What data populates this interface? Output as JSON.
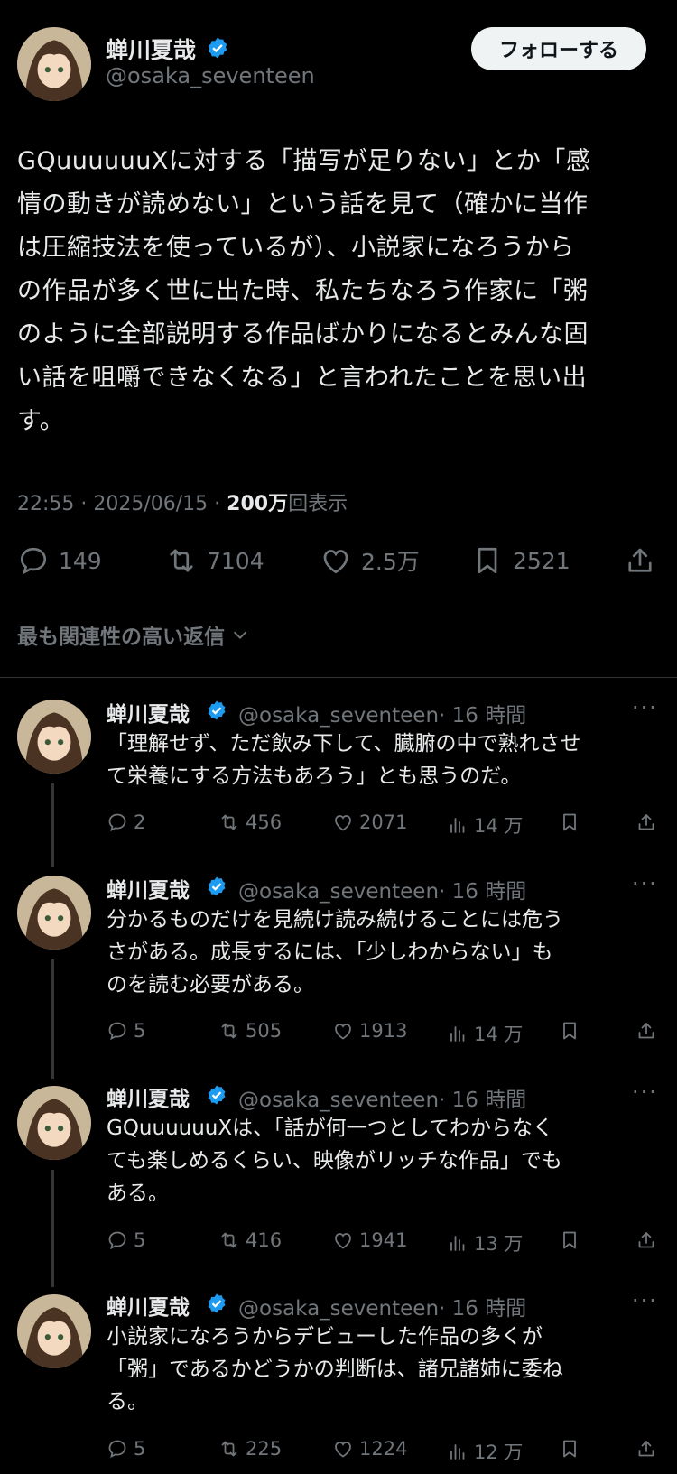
{
  "author": {
    "name": "蝉川夏哉",
    "handle": "@osaka_seventeen"
  },
  "follow_button": "フォローする",
  "post": {
    "lines": [
      "GQuuuuuuXに対する「描写が足りない」とか「感",
      "情の動きが読めない」という話を見て（確かに当作",
      "は圧縮技法を使っているが）、小説家になろうから",
      "の作品が多く世に出た時、私たちなろう作家に「粥",
      "のように全部説明する作品ばかりになるとみんな固",
      "い話を咀嚼できなくなる」と言われたことを思い出",
      "す。"
    ],
    "time": "22:55 · 2025/06/15 · ",
    "views": "200万",
    "views_suffix": "回表示",
    "stats": {
      "replies": "149",
      "reposts": "7104",
      "likes": "2.5万",
      "bookmarks": "2521"
    }
  },
  "sort_label": "最も関連性の高い返信",
  "replies": [
    {
      "name": "蝉川夏哉",
      "handle": "@osaka_seventeen",
      "time": "· 16 時間",
      "lines": [
        "「理解せず、ただ飲み下して、臓腑の中で熟れさせ",
        "て栄養にする方法もあろう」とも思うのだ。"
      ],
      "replies": "2",
      "reposts": "456",
      "likes": "2071",
      "views": "14 万"
    },
    {
      "name": "蝉川夏哉",
      "handle": "@osaka_seventeen",
      "time": "· 16 時間",
      "lines": [
        "分かるものだけを見続け読み続けることには危う",
        "さがある。成長するには、「少しわからない」も",
        "のを読む必要がある。"
      ],
      "replies": "5",
      "reposts": "505",
      "likes": "1913",
      "views": "14 万"
    },
    {
      "name": "蝉川夏哉",
      "handle": "@osaka_seventeen",
      "time": "· 16 時間",
      "lines": [
        "GQuuuuuuXは、「話が何一つとしてわからなく",
        "ても楽しめるくらい、映像がリッチな作品」でも",
        "ある。"
      ],
      "replies": "5",
      "reposts": "416",
      "likes": "1941",
      "views": "13 万"
    },
    {
      "name": "蝉川夏哉",
      "handle": "@osaka_seventeen",
      "time": "· 16 時間",
      "lines": [
        "小説家になろうからデビューした作品の多くが",
        "「粥」であるかどうかの判断は、諸兄諸姉に委ね",
        "る。"
      ],
      "replies": "5",
      "reposts": "225",
      "likes": "1224",
      "views": "12 万"
    }
  ],
  "colors": {
    "background": "#000000",
    "text": "#e7e9ea",
    "muted": "#71767b",
    "verified": "#1d9bf0"
  }
}
